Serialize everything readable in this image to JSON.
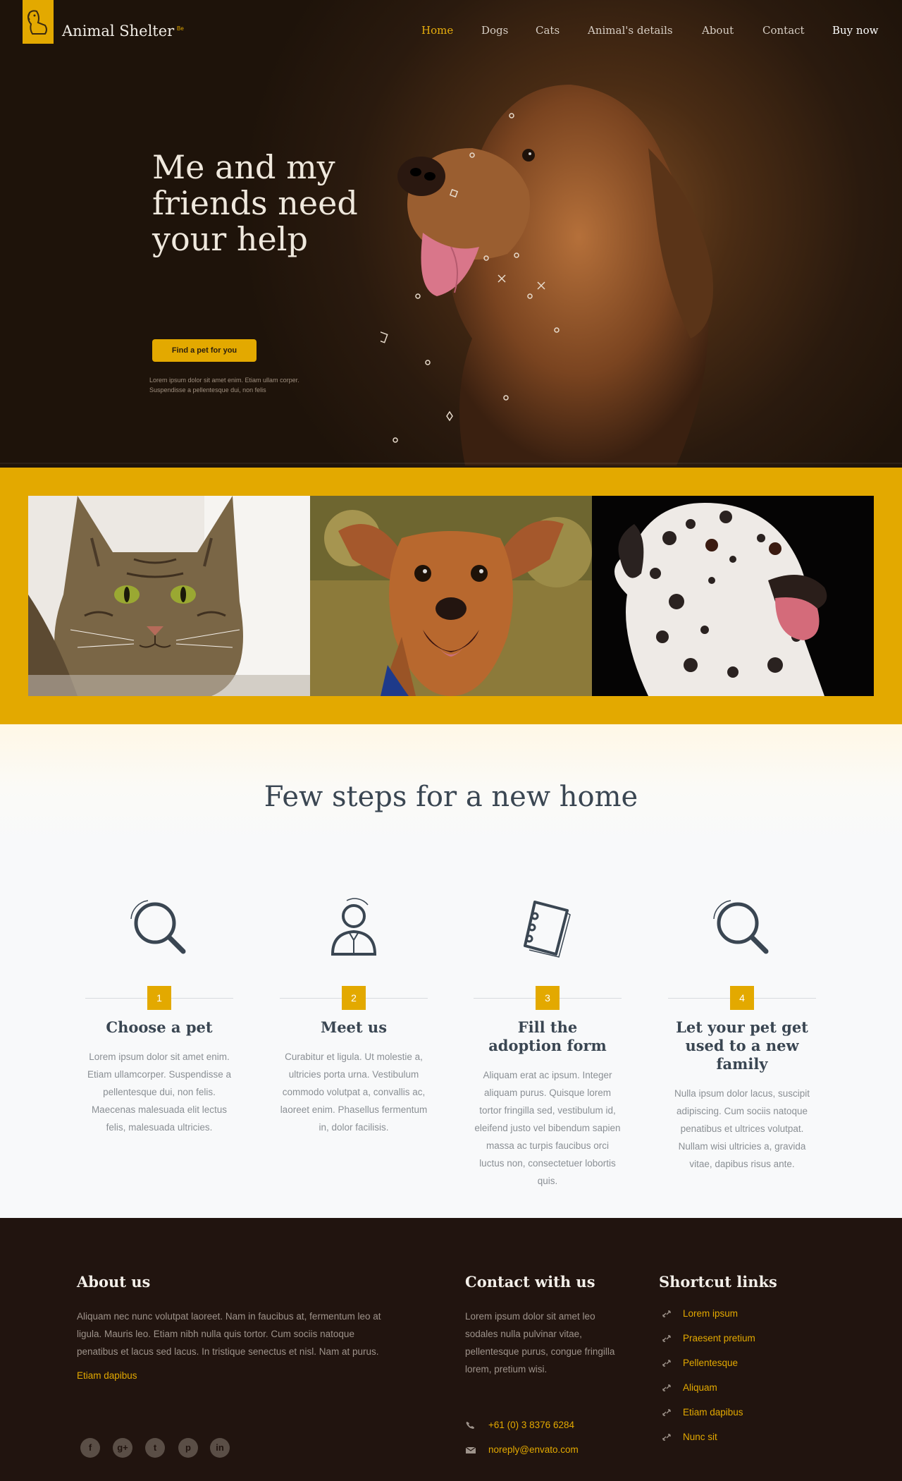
{
  "brand": {
    "name": "Animal Shelter",
    "sup": "Be",
    "accent": "#e3a900"
  },
  "nav": [
    {
      "label": "Home",
      "active": true
    },
    {
      "label": "Dogs"
    },
    {
      "label": "Cats"
    },
    {
      "label": "Animal's details"
    },
    {
      "label": "About"
    },
    {
      "label": "Contact"
    },
    {
      "label": "Buy now"
    }
  ],
  "hero": {
    "title": "Me and my friends need your help",
    "button": "Find a pet for you",
    "note": "Lorem ipsum dolor sit amet enim. Etiam ullam corper. Suspendisse a pellentesque dui, non felis"
  },
  "steps": {
    "title": "Few steps for a new home",
    "items": [
      {
        "num": "1",
        "title": "Choose a pet",
        "text": "Lorem ipsum dolor sit amet enim. Etiam ullamcorper. Suspendisse a pellentesque dui, non felis. Maecenas malesuada elit lectus felis, malesuada ultricies."
      },
      {
        "num": "2",
        "title": "Meet us",
        "text": "Curabitur et ligula. Ut molestie a, ultricies porta urna. Vestibulum commodo volutpat a, convallis ac, laoreet enim. Phasellus fermentum in, dolor facilisis."
      },
      {
        "num": "3",
        "title": "Fill the adoption form",
        "text": "Aliquam erat ac ipsum. Integer aliquam purus. Quisque lorem tortor fringilla sed, vestibulum id, eleifend justo vel bibendum sapien massa ac turpis faucibus orci luctus non, consectetuer lobortis quis."
      },
      {
        "num": "4",
        "title": "Let your pet get used to a new family",
        "text": "Nulla ipsum dolor lacus, suscipit adipiscing. Cum sociis natoque penatibus et ultrices volutpat. Nullam wisi ultricies a, gravida vitae, dapibus risus ante."
      }
    ]
  },
  "footer": {
    "about": {
      "title": "About us",
      "text": "Aliquam nec nunc volutpat laoreet. Nam in faucibus at, fermentum leo at ligula. Mauris leo. Etiam nibh nulla quis tortor. Cum sociis natoque penatibus et lacus sed lacus. In tristique senectus et nisl. Nam at purus.",
      "link": "Etiam dapibus"
    },
    "socials": [
      "f",
      "g+",
      "t",
      "p",
      "in"
    ],
    "contact": {
      "title": "Contact with us",
      "text": "Lorem ipsum dolor sit amet leo sodales nulla pulvinar vitae, pellentesque purus, congue fringilla lorem, pretium wisi.",
      "phone": "+61 (0) 3 8376 6284",
      "email": "noreply@envato.com"
    },
    "shortcuts": {
      "title": "Shortcut links",
      "links": [
        "Lorem ipsum",
        "Praesent pretium",
        "Pellentesque",
        "Aliquam",
        "Etiam dapibus",
        "Nunc sit"
      ]
    }
  }
}
